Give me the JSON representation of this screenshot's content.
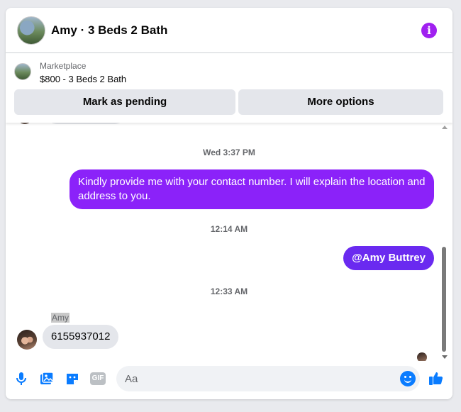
{
  "header": {
    "title": "Amy · 3 Beds 2 Bath",
    "info_glyph": "i"
  },
  "listing": {
    "label": "Marketplace",
    "title": "$800 - 3 Beds 2 Bath",
    "mark_pending_label": "Mark as pending",
    "more_options_label": "More options"
  },
  "messages": {
    "ts1": "Wed 3:37 PM",
    "msg1": "Kindly provide me with your contact number. I will explain the location and address to you.",
    "ts2": "12:14 AM",
    "msg2": "@Amy Buttrey",
    "ts3": "12:33 AM",
    "sender": "Amy",
    "msg3": "6155937012"
  },
  "composer": {
    "placeholder": "Aa",
    "gif_label": "GIF"
  },
  "colors": {
    "accent": "#0a7cff",
    "outgoing": "#8b22f9",
    "mention": "#6a2af0",
    "info": "#a020f0"
  },
  "icons": [
    "microphone-icon",
    "image-icon",
    "sticker-icon",
    "gif-icon",
    "emoji-icon",
    "thumbs-up-icon",
    "info-icon"
  ]
}
